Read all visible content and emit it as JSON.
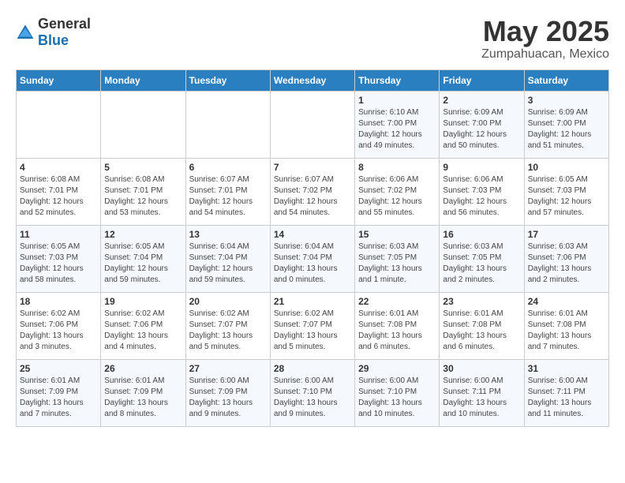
{
  "logo": {
    "general": "General",
    "blue": "Blue"
  },
  "title": "May 2025",
  "location": "Zumpahuacan, Mexico",
  "days_of_week": [
    "Sunday",
    "Monday",
    "Tuesday",
    "Wednesday",
    "Thursday",
    "Friday",
    "Saturday"
  ],
  "weeks": [
    [
      {
        "day": "",
        "info": ""
      },
      {
        "day": "",
        "info": ""
      },
      {
        "day": "",
        "info": ""
      },
      {
        "day": "",
        "info": ""
      },
      {
        "day": "1",
        "info": "Sunrise: 6:10 AM\nSunset: 7:00 PM\nDaylight: 12 hours\nand 49 minutes."
      },
      {
        "day": "2",
        "info": "Sunrise: 6:09 AM\nSunset: 7:00 PM\nDaylight: 12 hours\nand 50 minutes."
      },
      {
        "day": "3",
        "info": "Sunrise: 6:09 AM\nSunset: 7:00 PM\nDaylight: 12 hours\nand 51 minutes."
      }
    ],
    [
      {
        "day": "4",
        "info": "Sunrise: 6:08 AM\nSunset: 7:01 PM\nDaylight: 12 hours\nand 52 minutes."
      },
      {
        "day": "5",
        "info": "Sunrise: 6:08 AM\nSunset: 7:01 PM\nDaylight: 12 hours\nand 53 minutes."
      },
      {
        "day": "6",
        "info": "Sunrise: 6:07 AM\nSunset: 7:01 PM\nDaylight: 12 hours\nand 54 minutes."
      },
      {
        "day": "7",
        "info": "Sunrise: 6:07 AM\nSunset: 7:02 PM\nDaylight: 12 hours\nand 54 minutes."
      },
      {
        "day": "8",
        "info": "Sunrise: 6:06 AM\nSunset: 7:02 PM\nDaylight: 12 hours\nand 55 minutes."
      },
      {
        "day": "9",
        "info": "Sunrise: 6:06 AM\nSunset: 7:03 PM\nDaylight: 12 hours\nand 56 minutes."
      },
      {
        "day": "10",
        "info": "Sunrise: 6:05 AM\nSunset: 7:03 PM\nDaylight: 12 hours\nand 57 minutes."
      }
    ],
    [
      {
        "day": "11",
        "info": "Sunrise: 6:05 AM\nSunset: 7:03 PM\nDaylight: 12 hours\nand 58 minutes."
      },
      {
        "day": "12",
        "info": "Sunrise: 6:05 AM\nSunset: 7:04 PM\nDaylight: 12 hours\nand 59 minutes."
      },
      {
        "day": "13",
        "info": "Sunrise: 6:04 AM\nSunset: 7:04 PM\nDaylight: 12 hours\nand 59 minutes."
      },
      {
        "day": "14",
        "info": "Sunrise: 6:04 AM\nSunset: 7:04 PM\nDaylight: 13 hours\nand 0 minutes."
      },
      {
        "day": "15",
        "info": "Sunrise: 6:03 AM\nSunset: 7:05 PM\nDaylight: 13 hours\nand 1 minute."
      },
      {
        "day": "16",
        "info": "Sunrise: 6:03 AM\nSunset: 7:05 PM\nDaylight: 13 hours\nand 2 minutes."
      },
      {
        "day": "17",
        "info": "Sunrise: 6:03 AM\nSunset: 7:06 PM\nDaylight: 13 hours\nand 2 minutes."
      }
    ],
    [
      {
        "day": "18",
        "info": "Sunrise: 6:02 AM\nSunset: 7:06 PM\nDaylight: 13 hours\nand 3 minutes."
      },
      {
        "day": "19",
        "info": "Sunrise: 6:02 AM\nSunset: 7:06 PM\nDaylight: 13 hours\nand 4 minutes."
      },
      {
        "day": "20",
        "info": "Sunrise: 6:02 AM\nSunset: 7:07 PM\nDaylight: 13 hours\nand 5 minutes."
      },
      {
        "day": "21",
        "info": "Sunrise: 6:02 AM\nSunset: 7:07 PM\nDaylight: 13 hours\nand 5 minutes."
      },
      {
        "day": "22",
        "info": "Sunrise: 6:01 AM\nSunset: 7:08 PM\nDaylight: 13 hours\nand 6 minutes."
      },
      {
        "day": "23",
        "info": "Sunrise: 6:01 AM\nSunset: 7:08 PM\nDaylight: 13 hours\nand 6 minutes."
      },
      {
        "day": "24",
        "info": "Sunrise: 6:01 AM\nSunset: 7:08 PM\nDaylight: 13 hours\nand 7 minutes."
      }
    ],
    [
      {
        "day": "25",
        "info": "Sunrise: 6:01 AM\nSunset: 7:09 PM\nDaylight: 13 hours\nand 7 minutes."
      },
      {
        "day": "26",
        "info": "Sunrise: 6:01 AM\nSunset: 7:09 PM\nDaylight: 13 hours\nand 8 minutes."
      },
      {
        "day": "27",
        "info": "Sunrise: 6:00 AM\nSunset: 7:09 PM\nDaylight: 13 hours\nand 9 minutes."
      },
      {
        "day": "28",
        "info": "Sunrise: 6:00 AM\nSunset: 7:10 PM\nDaylight: 13 hours\nand 9 minutes."
      },
      {
        "day": "29",
        "info": "Sunrise: 6:00 AM\nSunset: 7:10 PM\nDaylight: 13 hours\nand 10 minutes."
      },
      {
        "day": "30",
        "info": "Sunrise: 6:00 AM\nSunset: 7:11 PM\nDaylight: 13 hours\nand 10 minutes."
      },
      {
        "day": "31",
        "info": "Sunrise: 6:00 AM\nSunset: 7:11 PM\nDaylight: 13 hours\nand 11 minutes."
      }
    ]
  ]
}
